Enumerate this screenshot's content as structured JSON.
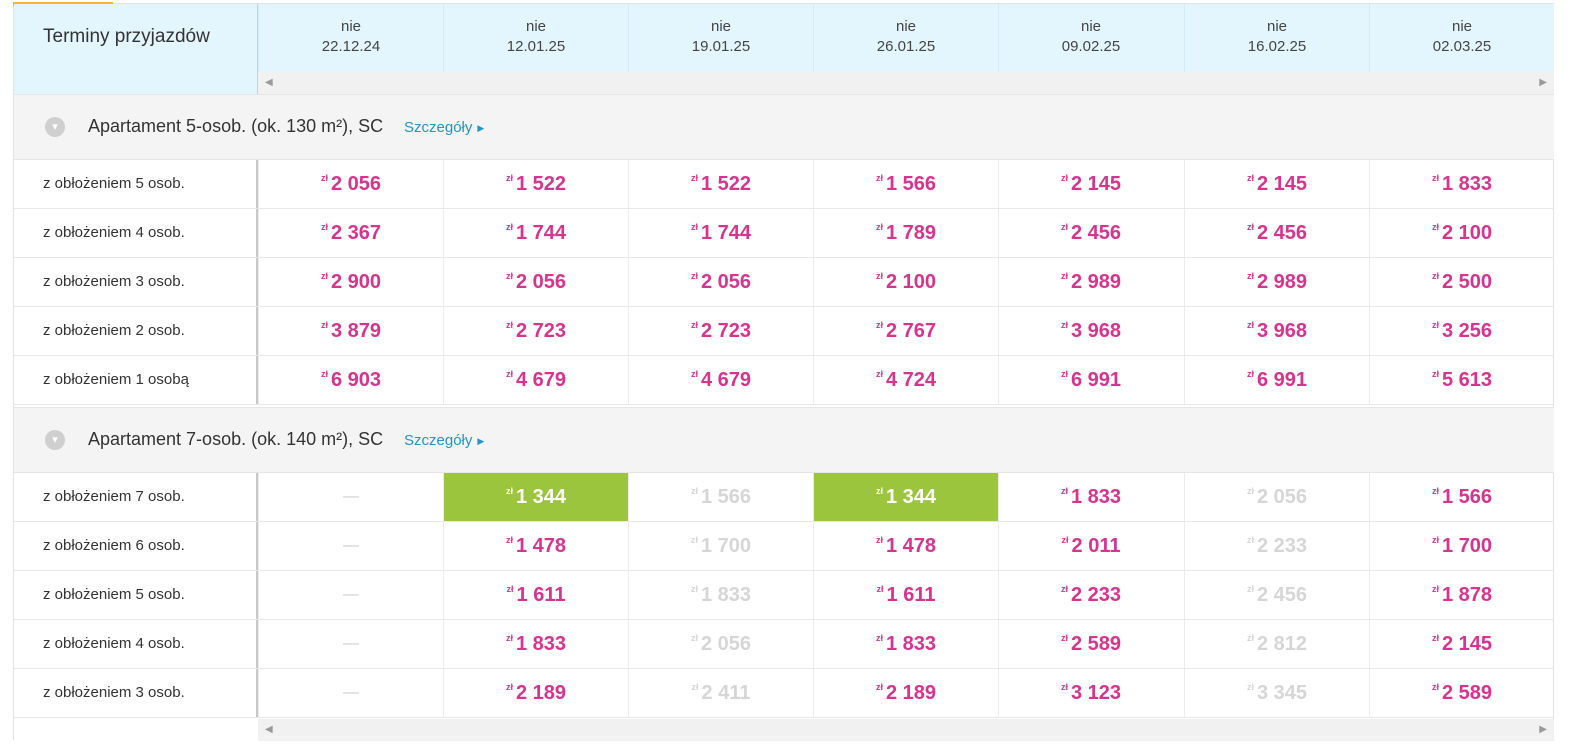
{
  "header": {
    "label": "Terminy przyjazdów",
    "dates": [
      {
        "dow": "nie",
        "date": "22.12.24"
      },
      {
        "dow": "nie",
        "date": "12.01.25"
      },
      {
        "dow": "nie",
        "date": "19.01.25"
      },
      {
        "dow": "nie",
        "date": "26.01.25"
      },
      {
        "dow": "nie",
        "date": "09.02.25"
      },
      {
        "dow": "nie",
        "date": "16.02.25"
      },
      {
        "dow": "nie",
        "date": "02.03.25"
      }
    ]
  },
  "currency": "zł",
  "sections": [
    {
      "title": "Apartament 5-osob. (ok. 130 m²), SC",
      "details_label": "Szczegóły",
      "rows": [
        {
          "label": "z obłożeniem 5 osob.",
          "cells": [
            {
              "v": "2 056",
              "s": "ok"
            },
            {
              "v": "1 522",
              "s": "ok"
            },
            {
              "v": "1 522",
              "s": "ok"
            },
            {
              "v": "1 566",
              "s": "ok"
            },
            {
              "v": "2 145",
              "s": "ok"
            },
            {
              "v": "2 145",
              "s": "ok"
            },
            {
              "v": "1 833",
              "s": "ok"
            }
          ]
        },
        {
          "label": "z obłożeniem 4 osob.",
          "cells": [
            {
              "v": "2 367",
              "s": "ok"
            },
            {
              "v": "1 744",
              "s": "ok"
            },
            {
              "v": "1 744",
              "s": "ok"
            },
            {
              "v": "1 789",
              "s": "ok"
            },
            {
              "v": "2 456",
              "s": "ok"
            },
            {
              "v": "2 456",
              "s": "ok"
            },
            {
              "v": "2 100",
              "s": "ok"
            }
          ]
        },
        {
          "label": "z obłożeniem 3 osob.",
          "cells": [
            {
              "v": "2 900",
              "s": "ok"
            },
            {
              "v": "2 056",
              "s": "ok"
            },
            {
              "v": "2 056",
              "s": "ok"
            },
            {
              "v": "2 100",
              "s": "ok"
            },
            {
              "v": "2 989",
              "s": "ok"
            },
            {
              "v": "2 989",
              "s": "ok"
            },
            {
              "v": "2 500",
              "s": "ok"
            }
          ]
        },
        {
          "label": "z obłożeniem 2 osob.",
          "cells": [
            {
              "v": "3 879",
              "s": "ok"
            },
            {
              "v": "2 723",
              "s": "ok"
            },
            {
              "v": "2 723",
              "s": "ok"
            },
            {
              "v": "2 767",
              "s": "ok"
            },
            {
              "v": "3 968",
              "s": "ok"
            },
            {
              "v": "3 968",
              "s": "ok"
            },
            {
              "v": "3 256",
              "s": "ok"
            }
          ]
        },
        {
          "label": "z obłożeniem 1 osobą",
          "cells": [
            {
              "v": "6 903",
              "s": "ok"
            },
            {
              "v": "4 679",
              "s": "ok"
            },
            {
              "v": "4 679",
              "s": "ok"
            },
            {
              "v": "4 724",
              "s": "ok"
            },
            {
              "v": "6 991",
              "s": "ok"
            },
            {
              "v": "6 991",
              "s": "ok"
            },
            {
              "v": "5 613",
              "s": "ok"
            }
          ]
        }
      ]
    },
    {
      "title": "Apartament 7-osob. (ok. 140 m²), SC",
      "details_label": "Szczegóły",
      "rows": [
        {
          "label": "z obłożeniem 7 osob.",
          "cells": [
            {
              "v": "—",
              "s": "dash"
            },
            {
              "v": "1 344",
              "s": "best"
            },
            {
              "v": "1 566",
              "s": "na"
            },
            {
              "v": "1 344",
              "s": "best"
            },
            {
              "v": "1 833",
              "s": "ok"
            },
            {
              "v": "2 056",
              "s": "na"
            },
            {
              "v": "1 566",
              "s": "ok"
            }
          ]
        },
        {
          "label": "z obłożeniem 6 osob.",
          "cells": [
            {
              "v": "—",
              "s": "dash"
            },
            {
              "v": "1 478",
              "s": "ok"
            },
            {
              "v": "1 700",
              "s": "na"
            },
            {
              "v": "1 478",
              "s": "ok"
            },
            {
              "v": "2 011",
              "s": "ok"
            },
            {
              "v": "2 233",
              "s": "na"
            },
            {
              "v": "1 700",
              "s": "ok"
            }
          ]
        },
        {
          "label": "z obłożeniem 5 osob.",
          "cells": [
            {
              "v": "—",
              "s": "dash"
            },
            {
              "v": "1 611",
              "s": "ok"
            },
            {
              "v": "1 833",
              "s": "na"
            },
            {
              "v": "1 611",
              "s": "ok"
            },
            {
              "v": "2 233",
              "s": "ok"
            },
            {
              "v": "2 456",
              "s": "na"
            },
            {
              "v": "1 878",
              "s": "ok"
            }
          ]
        },
        {
          "label": "z obłożeniem 4 osob.",
          "cells": [
            {
              "v": "—",
              "s": "dash"
            },
            {
              "v": "1 833",
              "s": "ok"
            },
            {
              "v": "2 056",
              "s": "na"
            },
            {
              "v": "1 833",
              "s": "ok"
            },
            {
              "v": "2 589",
              "s": "ok"
            },
            {
              "v": "2 812",
              "s": "na"
            },
            {
              "v": "2 145",
              "s": "ok"
            }
          ]
        },
        {
          "label": "z obłożeniem 3 osob.",
          "cells": [
            {
              "v": "—",
              "s": "dash"
            },
            {
              "v": "2 189",
              "s": "ok"
            },
            {
              "v": "2 411",
              "s": "na"
            },
            {
              "v": "2 189",
              "s": "ok"
            },
            {
              "v": "3 123",
              "s": "ok"
            },
            {
              "v": "3 345",
              "s": "na"
            },
            {
              "v": "2 589",
              "s": "ok"
            }
          ]
        }
      ]
    }
  ],
  "colors": {
    "price": "#d8338f",
    "unavailable": "#d6d6d6",
    "best": "#9bc53d",
    "accent": "#f5b82e",
    "header_bg": "#e3f6fd",
    "link": "#2196c9"
  },
  "icons": {
    "collapse": "chevron-down-icon",
    "details": "caret-right-icon",
    "scroll_left": "arrow-left-icon",
    "scroll_right": "arrow-right-icon"
  }
}
